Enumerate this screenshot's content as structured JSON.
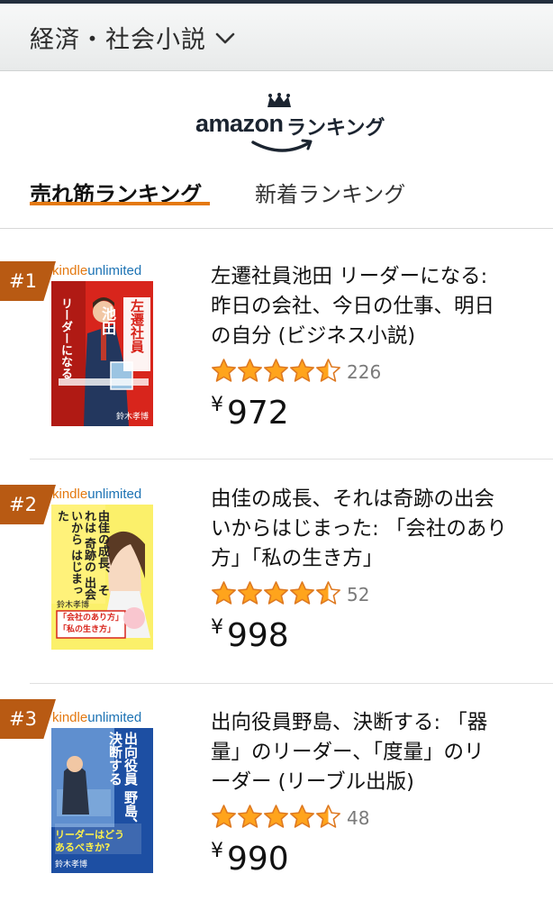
{
  "header": {
    "category": "経済・社会小説"
  },
  "logo": {
    "brand": "amazon",
    "suffix": "ランキング"
  },
  "tabs": [
    {
      "label": "売れ筋ランキング",
      "active": true
    },
    {
      "label": "新着ランキング",
      "active": false
    }
  ],
  "colors": {
    "accent": "#e47911",
    "rank_badge": "#b85a13",
    "star": "#ffa41c"
  },
  "items": [
    {
      "rank": "#1",
      "title_lines": [
        "左遷社員池田 リーダーになる:",
        "昨日の会社、今日の仕事、明日",
        "の自分 (ビジネス小説)"
      ],
      "rating": 4.5,
      "reviews": "226",
      "price_symbol": "¥",
      "price": "972",
      "cover": {
        "badge_a": "kindle",
        "badge_b": "unlimited",
        "title_lines": [
          "左遷社員",
          "池田",
          "リーダーになる"
        ],
        "author": "鈴木孝博"
      }
    },
    {
      "rank": "#2",
      "title_lines": [
        "由佳の成長、それは奇跡の出会",
        "いからはじまった: 「会社のあり",
        "方」「私の生き方」"
      ],
      "rating": 4.5,
      "reviews": "52",
      "price_symbol": "¥",
      "price": "998",
      "cover": {
        "badge_a": "kindle",
        "badge_b": "unlimited",
        "title_lines": [
          "由佳の成長、",
          "それは",
          "奇跡の",
          "出会いから",
          "はじまった"
        ],
        "author": "鈴木孝博",
        "banner": [
          "「会社のあり方」",
          "「私の生き方」"
        ]
      }
    },
    {
      "rank": "#3",
      "title_lines": [
        "出向役員野島、決断する: 「器",
        "量」のリーダー、「度量」のリ",
        "ーダー (リーブル出版)"
      ],
      "rating": 4.5,
      "reviews": "48",
      "price_symbol": "¥",
      "price": "990",
      "cover": {
        "badge_a": "kindle",
        "badge_b": "unlimited",
        "title_lines": [
          "出向役員",
          "野島、",
          "決断する"
        ],
        "tagline": [
          "リーダーはどう",
          "あるべきか?"
        ],
        "author": "鈴木孝博"
      }
    }
  ]
}
